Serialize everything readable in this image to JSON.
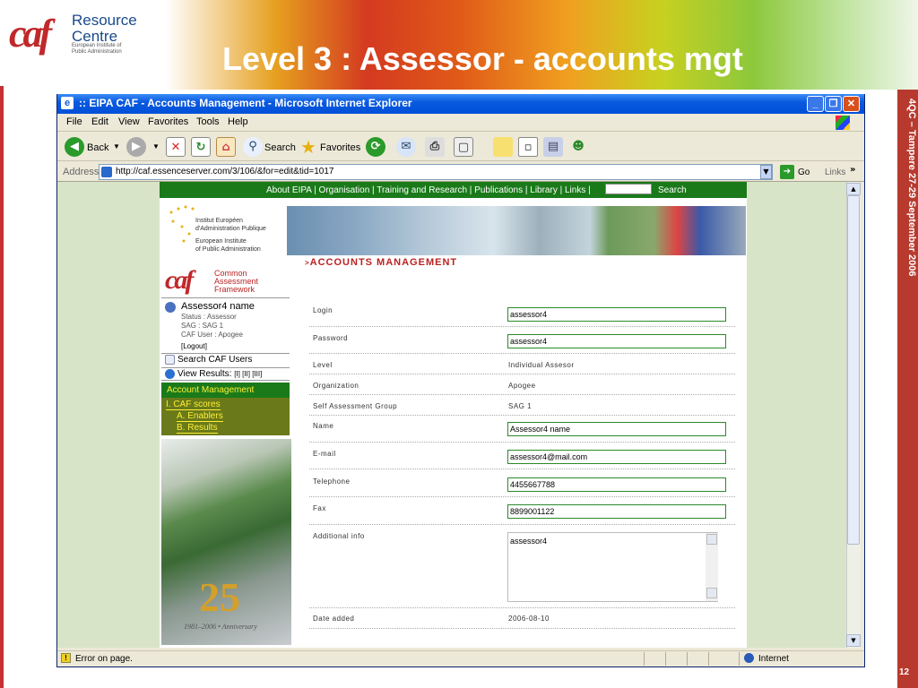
{
  "slide": {
    "title": "Level 3 : Assessor -  accounts mgt",
    "logo_mark": "caf",
    "logo_title_1": "Resource",
    "logo_title_2": "Centre",
    "logo_sub_1": "European Institute of",
    "logo_sub_2": "Public Administration",
    "side_text": "4QC – Tampere 27-29 September 2006",
    "page_number": "12"
  },
  "browser": {
    "window_title": ":: EIPA CAF - Accounts Management - Microsoft Internet Explorer",
    "menu": [
      "File",
      "Edit",
      "View",
      "Favorites",
      "Tools",
      "Help"
    ],
    "toolbar": {
      "back": "Back",
      "search": "Search",
      "favorites": "Favorites"
    },
    "address_label": "Address",
    "url": "http://caf.essenceserver.com/3/106/&for=edit&tid=1017",
    "go": "Go",
    "links": "Links",
    "status_text": "Error on page.",
    "zone": "Internet"
  },
  "site": {
    "nav": "About EIPA  |  Organisation  |  Training and Research  |  Publications  |  Library  |  Links  |",
    "search_label": "Search",
    "eipa_lines": [
      "Institut Européen",
      "d'Administration Publique",
      "European Institute",
      "of Public Administration"
    ],
    "caf_logo_mark": "caf",
    "caf_lines": [
      "Common",
      "Assessment",
      "Framework"
    ],
    "user": {
      "name": "Assessor4 name",
      "status": "Status : Assessor",
      "sag": "SAG : SAG 1",
      "caf_user": "CAF User : Apogee",
      "logout": "[Logout]"
    },
    "search_users": "Search CAF Users",
    "view_results": "View Results:",
    "view_links": "[I] [II] [III]",
    "account_management": "Account Management",
    "caf_scores": "I. CAF scores",
    "enablers": "A. Enablers",
    "results": "B. Results",
    "anniversary_number": "25",
    "anniversary_years": "1981–2006 • Anniversary"
  },
  "form": {
    "title": "ACCOUNTS MANAGEMENT",
    "login_label": "Login",
    "login_value": "assessor4",
    "password_label": "Password",
    "password_value": "assessor4",
    "level_label": "Level",
    "level_value": "Individual Assesor",
    "organization_label": "Organization",
    "organization_value": "Apogee",
    "sag_label": "Self Assessment Group",
    "sag_value": "SAG 1",
    "name_label": "Name",
    "name_value": "Assessor4 name",
    "email_label": "E-mail",
    "email_value": "assessor4@mail.com",
    "telephone_label": "Telephone",
    "telephone_value": "4455667788",
    "fax_label": "Fax",
    "fax_value": "8899001122",
    "additional_label": "Additional info",
    "additional_value": "assessor4",
    "date_label": "Date added",
    "date_value": "2006-08-10"
  },
  "colors": {
    "accent_red": "#c0282a",
    "site_green": "#1a7a1a",
    "ie_blue": "#0a5adf"
  }
}
